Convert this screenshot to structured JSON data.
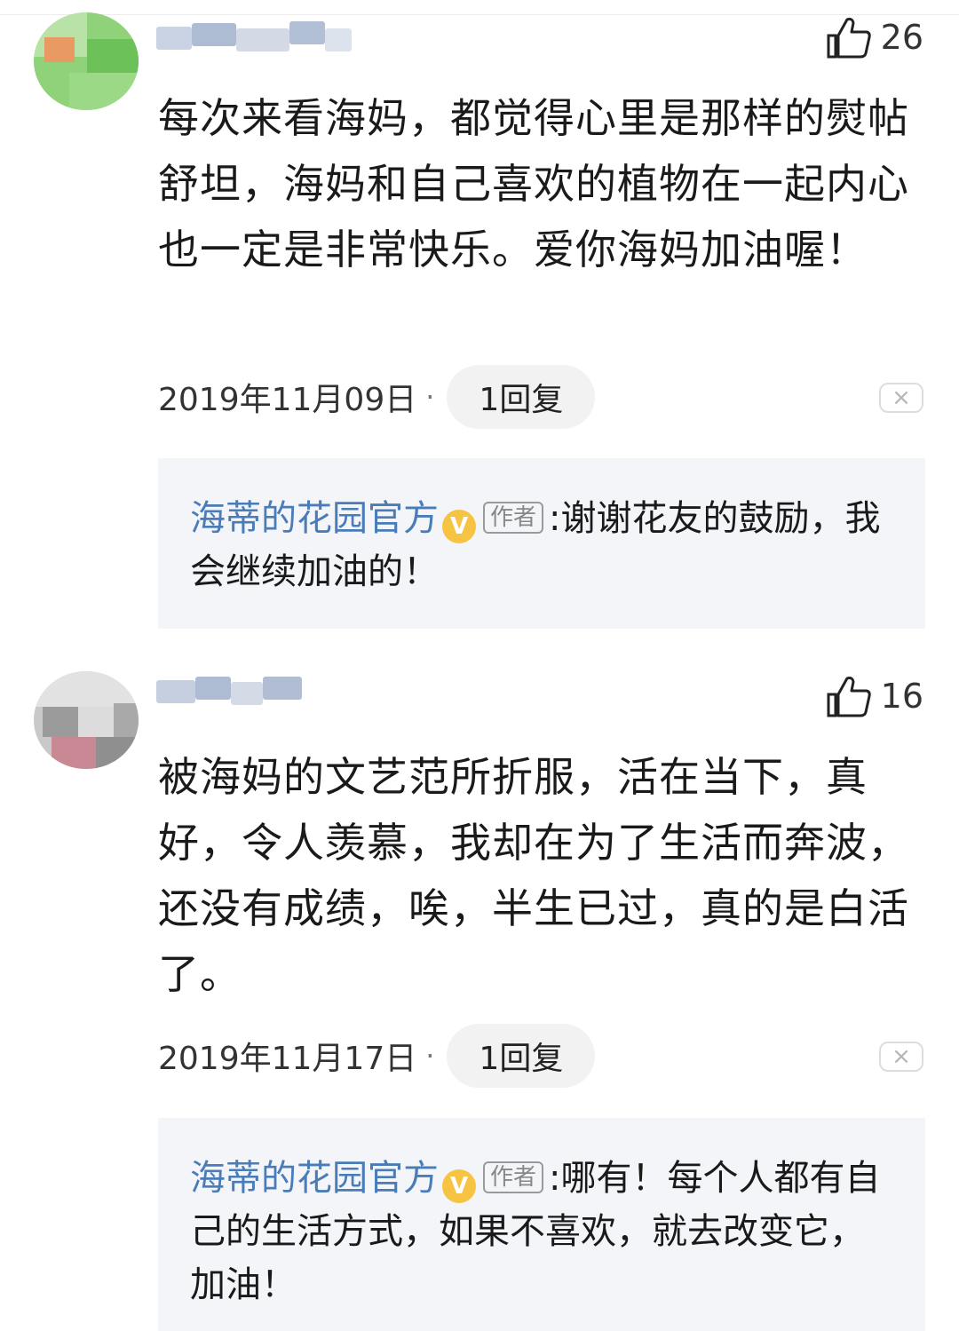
{
  "comments": [
    {
      "likes": "26",
      "text": "每次来看海妈，都觉得心里是那样的熨帖舒坦，海妈和自己喜欢的植物在一起内心也一定是非常快乐。爱你海妈加油喔！",
      "date": "2019年11月09日",
      "separator": "·",
      "reply_count": "1回复",
      "close_symbol": "×",
      "reply": {
        "author": "海蒂的花园官方",
        "verified_badge": "V",
        "role": "作者",
        "separator": ":",
        "text": "谢谢花友的鼓励，我会继续加油的！"
      }
    },
    {
      "likes": "16",
      "text": "被海妈的文艺范所折服，活在当下，真好，令人羡慕，我却在为了生活而奔波，还没有成绩，唉，半生已过，真的是白活了。",
      "date": "2019年11月17日",
      "separator": "·",
      "reply_count": "1回复",
      "close_symbol": "×",
      "reply": {
        "author": "海蒂的花园官方",
        "verified_badge": "V",
        "role": "作者",
        "separator": ":",
        "text": "哪有！每个人都有自己的生活方式，如果不喜欢，就去改变它，加油！"
      }
    }
  ],
  "icons": {
    "like": "thumbs-up-icon",
    "close": "close-icon",
    "verified": "verified-badge-icon"
  },
  "colors": {
    "author": "#4a7cb8",
    "badge": "#f6c343",
    "reply_bg": "#f3f5f8"
  }
}
